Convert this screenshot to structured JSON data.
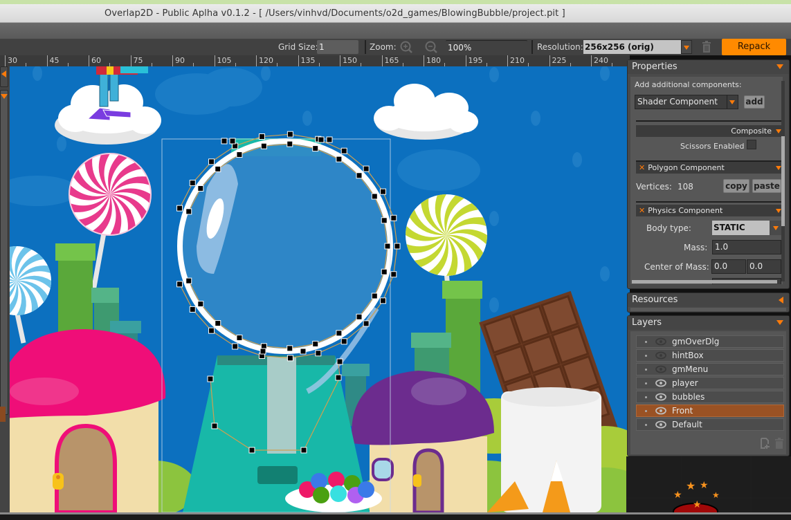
{
  "window": {
    "title": "Overlap2D - Public Aplha v0.1.2 - [ /Users/vinhvd/Documents/o2d_games/BlowingBubble/project.pit ]"
  },
  "toolbar": {
    "grid_size_label": "Grid Size:",
    "grid_size_value": "1",
    "zoom_label": "Zoom:",
    "zoom_value": "100%",
    "resolution_label": "Resolution:",
    "resolution_value": "256x256 (orig)",
    "repack_label": "Repack"
  },
  "ruler": {
    "ticks": [
      "30",
      "45",
      "60",
      "75",
      "90",
      "105",
      "120",
      "135",
      "150",
      "165",
      "180",
      "195",
      "210",
      "225",
      "240"
    ]
  },
  "properties": {
    "title": "Properties",
    "add_components_label": "Add additional components:",
    "component_select_value": "Shader Component",
    "add_button": "add",
    "composite_label": "Composite",
    "scissors_label": "Scissors Enabled",
    "scissors_checked": false,
    "polygon": {
      "title": "Polygon Component",
      "vertices_label": "Vertices:",
      "vertices_value": "108",
      "copy_button": "copy",
      "paste_button": "paste"
    },
    "physics": {
      "title": "Physics Component",
      "body_type_label": "Body type:",
      "body_type_value": "STATIC",
      "mass_label": "Mass:",
      "mass_value": "1.0",
      "center_of_mass_label": "Center of Mass:",
      "center_of_mass_x": "0.0",
      "center_of_mass_y": "0.0"
    }
  },
  "resources": {
    "title": "Resources"
  },
  "layers": {
    "title": "Layers",
    "items": [
      {
        "name": "gmOverDlg",
        "visible": false,
        "selected": false
      },
      {
        "name": "hintBox",
        "visible": false,
        "selected": false
      },
      {
        "name": "gmMenu",
        "visible": false,
        "selected": false
      },
      {
        "name": "player",
        "visible": true,
        "selected": false
      },
      {
        "name": "bubbles",
        "visible": true,
        "selected": false
      },
      {
        "name": "Front",
        "visible": true,
        "selected": true
      },
      {
        "name": "Default",
        "visible": true,
        "selected": false
      }
    ]
  },
  "colors": {
    "accent": "#ff8a00",
    "selected_layer": "#9a5224",
    "canvas_bg": "#0c70bf"
  }
}
